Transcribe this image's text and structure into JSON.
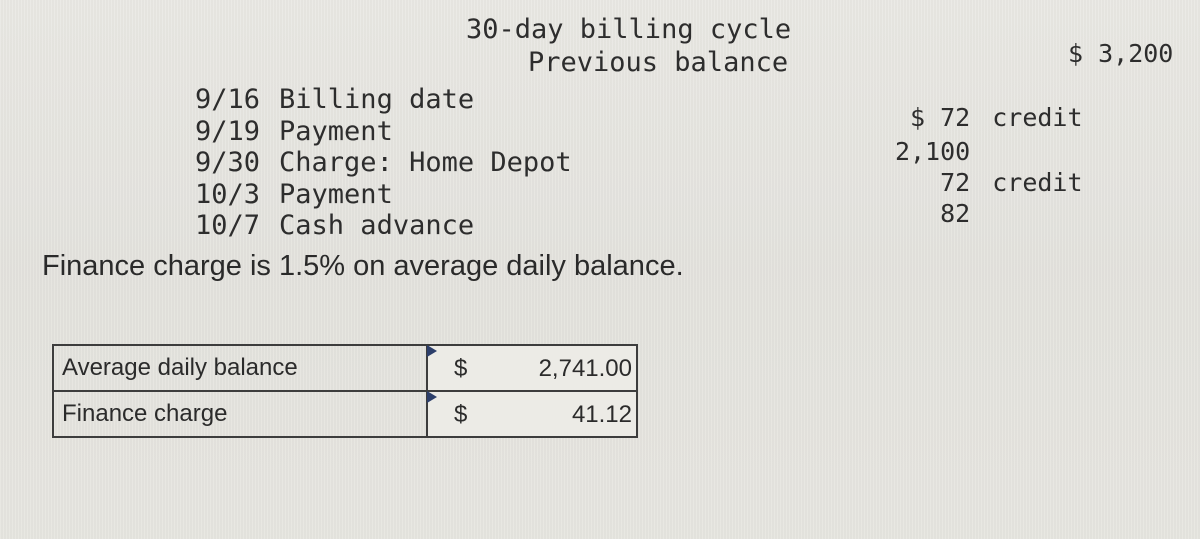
{
  "header": {
    "cycle_title": "30-day billing cycle",
    "previous_balance_label": "Previous balance",
    "previous_balance_amount": "$ 3,200"
  },
  "transactions": [
    {
      "date": "9/16",
      "description": "Billing date",
      "amount": "",
      "note": ""
    },
    {
      "date": "9/19",
      "description": "Payment",
      "amount": "$ 72",
      "note": "credit"
    },
    {
      "date": "9/30",
      "description": "Charge: Home Depot",
      "amount": "2,100",
      "note": ""
    },
    {
      "date": "10/3",
      "description": "Payment",
      "amount": "72",
      "note": "credit"
    },
    {
      "date": "10/7",
      "description": "Cash advance",
      "amount": "82",
      "note": ""
    }
  ],
  "finance_note": "Finance charge is 1.5% on average daily balance.",
  "summary": [
    {
      "label": "Average daily balance",
      "currency": "$",
      "value": "2,741.00"
    },
    {
      "label": "Finance charge",
      "currency": "$",
      "value": "41.12"
    }
  ]
}
